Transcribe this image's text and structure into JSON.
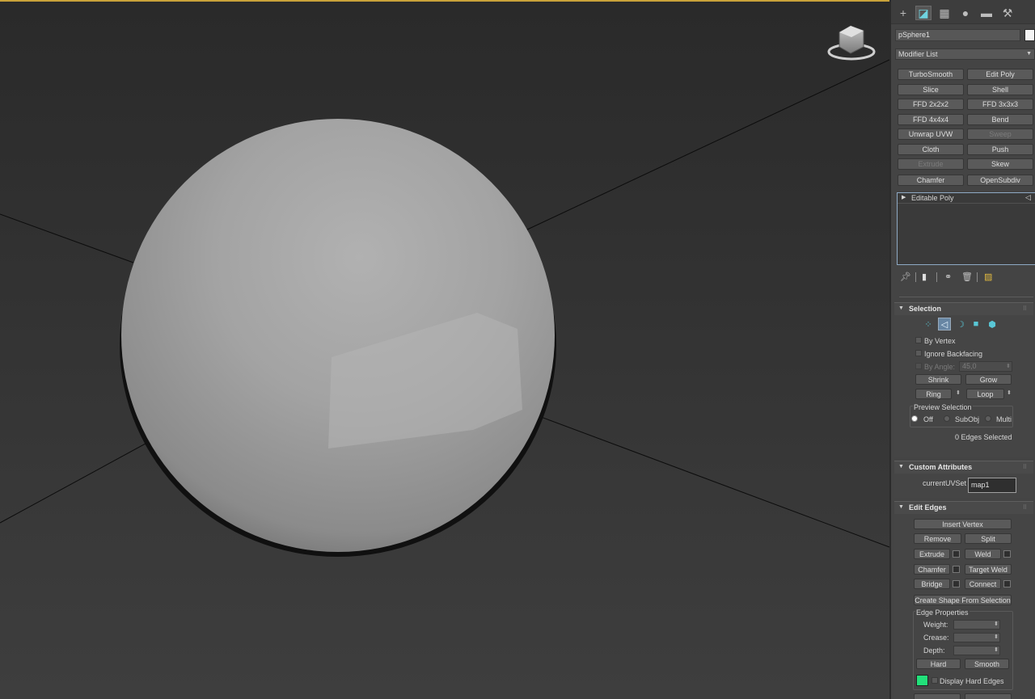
{
  "tabs": [
    {
      "name": "create",
      "glyph": "+"
    },
    {
      "name": "modify",
      "glyph": "◪"
    },
    {
      "name": "hierarchy",
      "glyph": "▦"
    },
    {
      "name": "motion",
      "glyph": "●"
    },
    {
      "name": "display",
      "glyph": "▬"
    },
    {
      "name": "utilities",
      "glyph": "⚒"
    }
  ],
  "object_name": "pSphere1",
  "modifier_list": "Modifier List",
  "modifier_buttons": [
    "TurboSmooth",
    "Edit Poly",
    "Slice",
    "Shell",
    "FFD 2x2x2",
    "FFD 3x3x3",
    "FFD 4x4x4",
    "Bend",
    "Unwrap UVW",
    "Sweep",
    "Cloth",
    "Push",
    "Extrude",
    "Skew",
    "Chamfer",
    "OpenSubdiv"
  ],
  "stack_item": "Editable Poly",
  "selection": {
    "title": "Selection",
    "by_vertex": "By Vertex",
    "ignore_backfacing": "Ignore Backfacing",
    "by_angle": "By Angle:",
    "angle_value": "45,0",
    "shrink": "Shrink",
    "grow": "Grow",
    "ring": "Ring",
    "loop": "Loop",
    "preview_selection": "Preview Selection",
    "off": "Off",
    "subobj": "SubObj",
    "multi": "Multi",
    "status": "0 Edges Selected"
  },
  "custom_attributes": {
    "title": "Custom Attributes",
    "uv_label": "currentUVSet",
    "uv_value": "map1"
  },
  "edit_edges": {
    "title": "Edit Edges",
    "insert_vertex": "Insert Vertex",
    "remove": "Remove",
    "split": "Split",
    "extrude": "Extrude",
    "weld": "Weld",
    "chamfer": "Chamfer",
    "target_weld": "Target Weld",
    "bridge": "Bridge",
    "connect": "Connect",
    "create_shape": "Create Shape From Selection",
    "edge_properties": "Edge Properties",
    "weight": "Weight:",
    "crease": "Crease:",
    "depth": "Depth:",
    "hard": "Hard",
    "smooth": "Smooth",
    "display_hard_edges": "Display Hard Edges",
    "hard_edge_color": "#22e07a"
  },
  "colors": {
    "viewport_border": "#c9a23a",
    "stack_border": "#8ea9c4",
    "accent": "#59c7d6"
  }
}
